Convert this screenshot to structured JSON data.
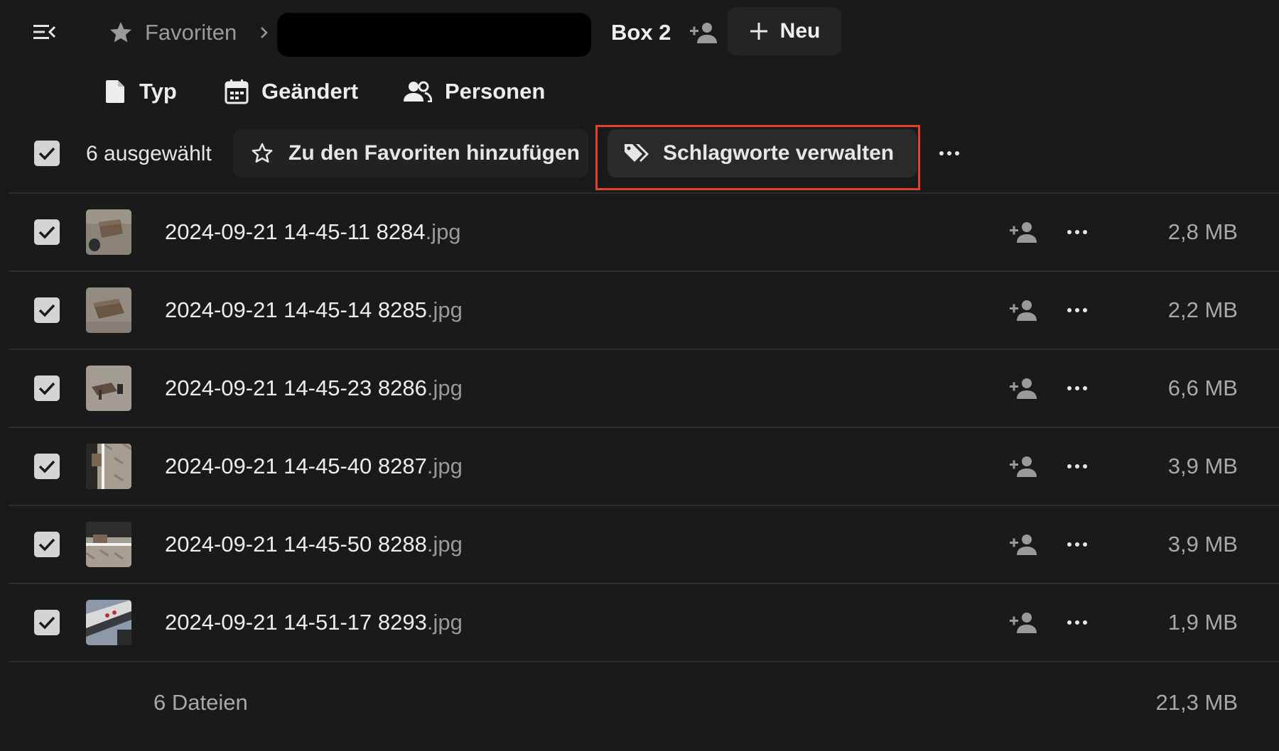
{
  "breadcrumb": {
    "favorites_label": "Favoriten",
    "current_folder": "Box 2"
  },
  "toolbar": {
    "new_label": "Neu"
  },
  "filters": [
    {
      "label": "Typ",
      "icon": "file-icon"
    },
    {
      "label": "Geändert",
      "icon": "calendar-icon"
    },
    {
      "label": "Personen",
      "icon": "people-icon"
    }
  ],
  "selection": {
    "count_label": "6 ausgewählt",
    "add_favorites_label": "Zu den Favoriten hinzufügen",
    "manage_tags_label": "Schlagworte verwalten"
  },
  "files": [
    {
      "name": "2024-09-21 14-45-11 8284",
      "ext": ".jpg",
      "size": "2,8 MB",
      "selected": true
    },
    {
      "name": "2024-09-21 14-45-14 8285",
      "ext": ".jpg",
      "size": "2,2 MB",
      "selected": true
    },
    {
      "name": "2024-09-21 14-45-23 8286",
      "ext": ".jpg",
      "size": "6,6 MB",
      "selected": true
    },
    {
      "name": "2024-09-21 14-45-40 8287",
      "ext": ".jpg",
      "size": "3,9 MB",
      "selected": true
    },
    {
      "name": "2024-09-21 14-45-50 8288",
      "ext": ".jpg",
      "size": "3,9 MB",
      "selected": true
    },
    {
      "name": "2024-09-21 14-51-17 8293",
      "ext": ".jpg",
      "size": "1,9 MB",
      "selected": true
    }
  ],
  "summary": {
    "count_label": "6 Dateien",
    "total_size": "21,3 MB"
  },
  "colors": {
    "background": "#1a1a1a",
    "highlight_border": "#e4412a",
    "checkbox": "#d4d4d4"
  }
}
